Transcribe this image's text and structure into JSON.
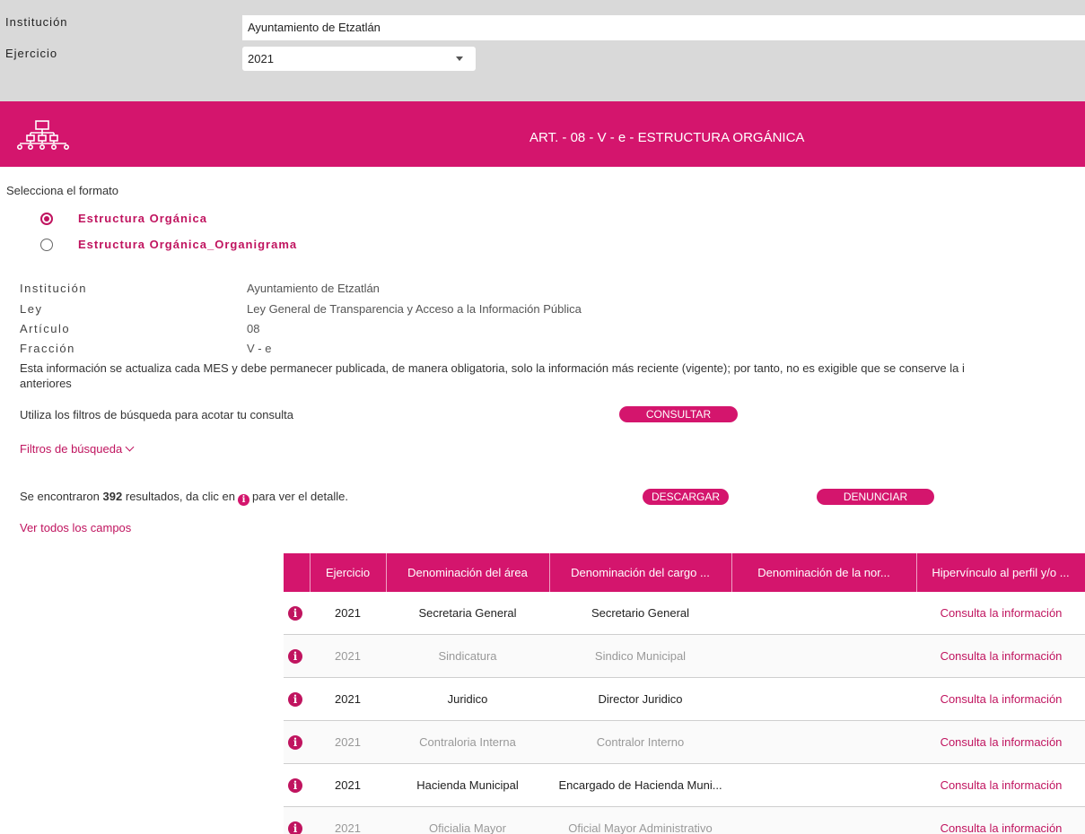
{
  "filters": {
    "institucion_label": "Institución",
    "institucion_value": "Ayuntamiento de Etzatlán",
    "ejercicio_label": "Ejercicio",
    "ejercicio_value": "2021"
  },
  "banner": {
    "title": "ART. - 08 - V - e - ESTRUCTURA ORGÁNICA",
    "icon": "org-chart-icon",
    "color": "#d4156d"
  },
  "formato": {
    "label": "Selecciona el formato",
    "options": [
      {
        "label": "Estructura Orgánica",
        "selected": true
      },
      {
        "label": "Estructura Orgánica_Organigrama",
        "selected": false
      }
    ]
  },
  "meta": {
    "institucion_label": "Institución",
    "institucion_value": "Ayuntamiento de Etzatlán",
    "ley_label": "Ley",
    "ley_value": "Ley General de Transparencia y Acceso a la Información Pública",
    "articulo_label": "Artículo",
    "articulo_value": "08",
    "fraccion_label": "Fracción",
    "fraccion_value": "V - e",
    "note_line1": "Esta información se actualiza cada MES y debe permanecer publicada, de manera obligatoria, solo la información más reciente (vigente); por tanto, no es exigible que se conserve la i",
    "note_line2": "anteriores"
  },
  "actions": {
    "filtros_text": "Utiliza los filtros de búsqueda para acotar tu consulta",
    "consultar_label": "CONSULTAR",
    "filtros_link": "Filtros de búsqueda",
    "results_pre": "Se encontraron",
    "results_count": "392",
    "results_mid": "resultados, da clic en",
    "results_post": "para ver el detalle.",
    "descargar_label": "DESCARGAR",
    "denunciar_label": "DENUNCIAR",
    "ver_todos": "Ver todos los campos"
  },
  "table": {
    "headers": [
      "Ejercicio",
      "Denominación del área",
      "Denominación del cargo ...",
      "Denominación de la nor...",
      "Hipervínculo al perfil y/o ..."
    ],
    "rows": [
      {
        "ejercicio": "2021",
        "area": "Secretaria General",
        "cargo": "Secretario General",
        "norma": "",
        "link": "Consulta la información",
        "tone": "dark"
      },
      {
        "ejercicio": "2021",
        "area": "Sindicatura",
        "cargo": "Sindico Municipal",
        "norma": "",
        "link": "Consulta la información",
        "tone": "light"
      },
      {
        "ejercicio": "2021",
        "area": "Juridico",
        "cargo": "Director Juridico",
        "norma": "",
        "link": "Consulta la información",
        "tone": "dark"
      },
      {
        "ejercicio": "2021",
        "area": "Contraloria Interna",
        "cargo": "Contralor Interno",
        "norma": "",
        "link": "Consulta la información",
        "tone": "light"
      },
      {
        "ejercicio": "2021",
        "area": "Hacienda Municipal",
        "cargo": "Encargado de Hacienda Muni...",
        "norma": "",
        "link": "Consulta la información",
        "tone": "dark"
      },
      {
        "ejercicio": "2021",
        "area": "Oficialia Mayor",
        "cargo": "Oficial Mayor Administrativo",
        "norma": "",
        "link": "Consulta la información",
        "tone": "light"
      }
    ]
  }
}
